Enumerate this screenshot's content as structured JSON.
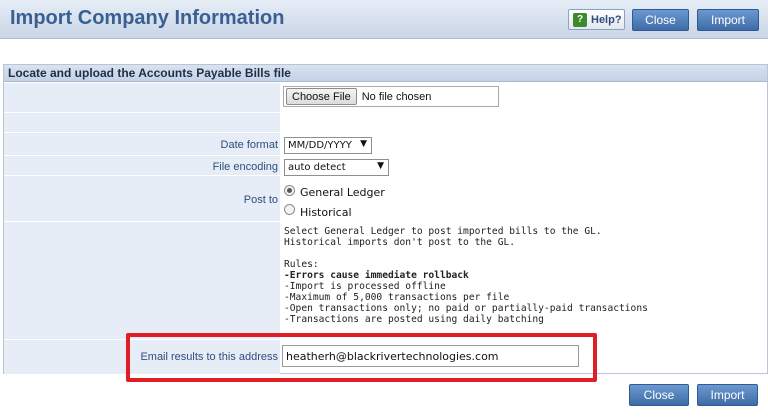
{
  "header": {
    "title": "Import Company Information",
    "help_label": "Help?",
    "help_icon_glyph": "?",
    "close_label": "Close",
    "import_label": "Import"
  },
  "section": {
    "title": "Locate and upload the Accounts Payable Bills file"
  },
  "file_input": {
    "button_label": "Choose File",
    "status": "No file chosen"
  },
  "fields": {
    "date_format_label": "Date format",
    "date_format_value": "MM/DD/YYYY",
    "file_encoding_label": "File encoding",
    "file_encoding_value": "auto detect",
    "post_to_label": "Post to",
    "post_to_options": [
      "General Ledger",
      "Historical"
    ],
    "post_to_selected": "General Ledger",
    "email_label": "Email results to this address",
    "email_value": "heatherh@blackrivertechnologies.com"
  },
  "info": {
    "line1": "Select General Ledger to post imported bills to the GL.",
    "line2": "Historical imports don't post to the GL.",
    "rules_heading": "Rules:",
    "rules": [
      "-Errors cause immediate rollback",
      "-Import is processed offline",
      "-Maximum of 5,000 transactions per file",
      "-Open transactions only; no paid or partially-paid transactions",
      "-Transactions are posted using daily batching"
    ]
  },
  "footer": {
    "close_label": "Close",
    "import_label": "Import"
  },
  "colors": {
    "accent": "#3f6ca8",
    "title": "#3a5f93",
    "highlight": "#e01e25"
  }
}
